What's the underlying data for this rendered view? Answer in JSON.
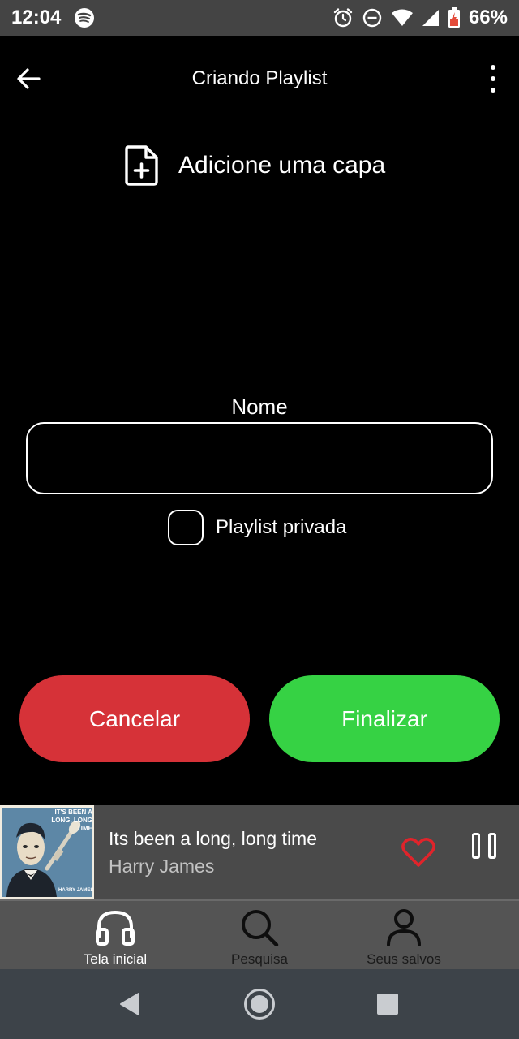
{
  "status_bar": {
    "time": "12:04",
    "battery": "66%",
    "icons": [
      "spotify-icon",
      "alarm-icon",
      "do-not-disturb-icon",
      "wifi-icon",
      "signal-icon",
      "battery-icon"
    ]
  },
  "app_bar": {
    "title": "Criando Playlist",
    "back_icon": "arrow-back-icon",
    "more_icon": "more-vert-icon"
  },
  "cover": {
    "label": "Adicione uma capa",
    "icon": "file-add-icon"
  },
  "form": {
    "name_label": "Nome",
    "name_value": "",
    "private_label": "Playlist privada",
    "private_checked": false
  },
  "actions": {
    "cancel_label": "Cancelar",
    "finish_label": "Finalizar",
    "cancel_color": "#d63238",
    "finish_color": "#36d244"
  },
  "player": {
    "album_art_text": "IT'S BEEN A LONG, LONG TIME",
    "album_art_artist": "HARRY JAMES",
    "title": "Its been a long, long time",
    "artist": "Harry James",
    "heart_color": "#e0242b"
  },
  "nav": {
    "items": [
      {
        "label": "Tela inicial",
        "icon": "headphones-icon",
        "active": true
      },
      {
        "label": "Pesquisa",
        "icon": "search-icon",
        "active": false
      },
      {
        "label": "Seus salvos",
        "icon": "user-icon",
        "active": false
      }
    ]
  },
  "system_nav": {
    "icons": [
      "back-triangle-icon",
      "home-circle-icon",
      "recents-square-icon"
    ]
  }
}
